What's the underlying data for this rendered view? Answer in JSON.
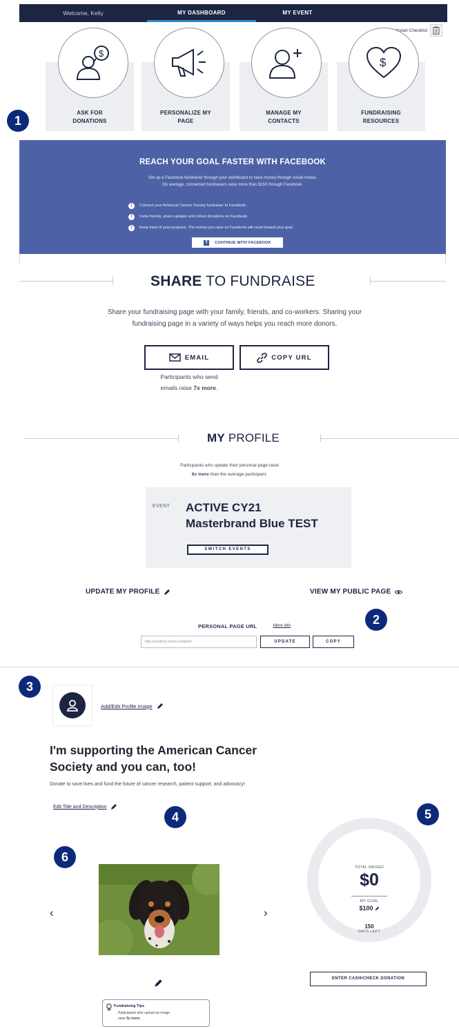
{
  "nav": {
    "welcome": "Welcome, Kelly",
    "dashboard": "MY DASHBOARD",
    "event": "MY EVENT"
  },
  "quickstart": {
    "label": "Show Quickstart Checklist"
  },
  "badges": [
    "1",
    "2",
    "3",
    "4",
    "5",
    "6"
  ],
  "tiles": [
    {
      "line1": "ASK FOR",
      "line2": "DONATIONS",
      "icon": "donation-person-icon"
    },
    {
      "line1": "PERSONALIZE MY",
      "line2": "PAGE",
      "icon": "megaphone-icon"
    },
    {
      "line1": "MANAGE MY",
      "line2": "CONTACTS",
      "icon": "add-contact-icon"
    },
    {
      "line1": "FUNDRAISING",
      "line2": "RESOURCES",
      "icon": "heart-dollar-icon"
    }
  ],
  "facebook": {
    "title": "REACH YOUR GOAL FASTER WITH FACEBOOK",
    "desc1": "Set up a Facebook fundraiser through your dashboard to raise money through social media.",
    "desc2": "On average, connected fundraisers raise more than $150 through Facebook.",
    "bullets": [
      "Connect your American Cancer Society fundraiser to Facebook.",
      "Invite friends, share updates and collect donations on Facebook.",
      "Keep track of your progress. The money you raise on Facebook will count toward your goal."
    ],
    "button": "CONTINUE WITH FACEBOOK"
  },
  "share": {
    "title_bold": "SHARE",
    "title_rest": " TO FUNDRAISE",
    "desc1": "Share your fundraising page with your family, friends, and co-workers. Sharing your",
    "desc2": "fundraising page in a variety of ways helps you reach more donors.",
    "email_btn": "EMAIL",
    "copy_btn": "COPY URL",
    "note1": "Participants who send",
    "note2_pre": "emails raise ",
    "note2_bold": "7x more",
    "note2_post": "."
  },
  "profile": {
    "title_bold": "MY",
    "title_rest": " PROFILE",
    "note1": "Participants who update their personal page raise",
    "note2_bold": "6x more",
    "note2_rest": " than the average participant.",
    "event_label": "EVENT",
    "event_line1": "ACTIVE CY21",
    "event_line2": "Masterbrand Blue TEST",
    "switch_btn": "SWITCH EVENTS",
    "update_link": "UPDATE MY PROFILE",
    "view_link": "VIEW MY PUBLIC PAGE",
    "url_label": "PERSONAL PAGE URL",
    "more_info": "More info",
    "url_value": "http://acsdev3.convio.net/goto/",
    "update_btn": "UPDATE",
    "copy_btn": "COPY"
  },
  "page": {
    "add_image": "Add/Edit Profile Image",
    "title": "I'm supporting the American Cancer Society and you can, too!",
    "desc": "Donate to save lives and fund the future of cancer research, patient support, and advocacy!",
    "edit_title": "Edit Title and Description"
  },
  "progress": {
    "raised_label": "TOTAL RAISED",
    "raised_value": "$0",
    "goal_label": "MY GOAL",
    "goal_value": "$100",
    "days_value": "150",
    "days_label": "DAYS LEFT",
    "cash_btn": "ENTER CASH/CHECK DONATION"
  },
  "tips": {
    "title": "Fundraising Tips",
    "body1": "Participants who upload an image",
    "body2_pre": "raise ",
    "body2_bold": "5x more",
    "body2_post": "."
  },
  "colors": {
    "navy": "#1c2541",
    "facebook_banner": "#4d62a6",
    "badge": "#0d2a7a",
    "tab_underline": "#2a8ad6"
  }
}
